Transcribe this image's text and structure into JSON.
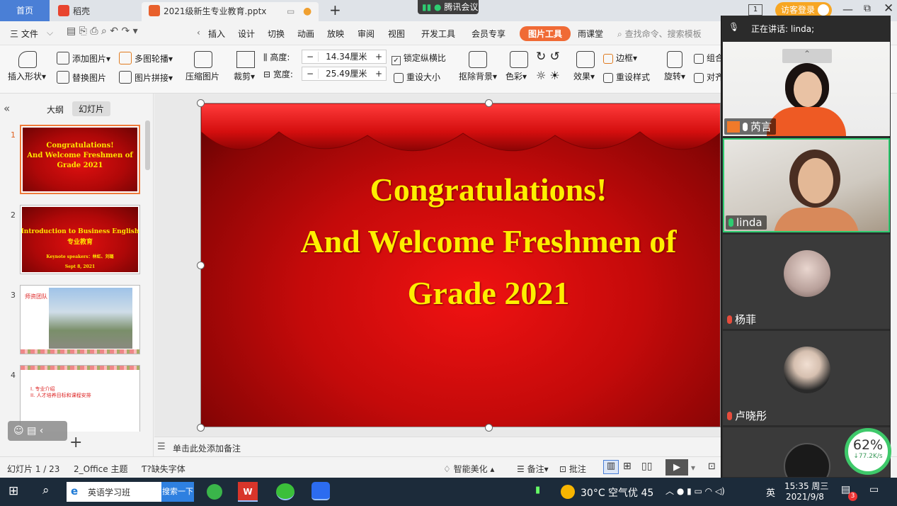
{
  "tabs": {
    "home": "首页",
    "docer": "稻壳",
    "file": "2021级新生专业教育.pptx",
    "meeting_app": "腾讯会议",
    "visitor_login": "访客登录"
  },
  "menu": {
    "file": "三 文件",
    "insert": "插入",
    "design": "设计",
    "transition": "切换",
    "animation": "动画",
    "slideshow": "放映",
    "review": "审阅",
    "view": "视图",
    "devtools": "开发工具",
    "member": "会员专享",
    "picture_tools": "图片工具",
    "rain_class": "雨课堂",
    "search": "查找命令、搜索模板"
  },
  "ribbon": {
    "insert_shape": "插入形状",
    "add_picture": "添加图片",
    "replace_picture": "替换图片",
    "multi_carousel": "多图轮播",
    "picture_splice": "图片拼接",
    "compress": "压缩图片",
    "crop": "裁剪",
    "height_label": "高度:",
    "height_value": "14.34厘米",
    "width_label": "宽度:",
    "width_value": "25.49厘米",
    "lock_ratio": "锁定纵横比",
    "reset_size": "重设大小",
    "remove_bg": "抠除背景",
    "color": "色彩",
    "effects": "效果",
    "border": "边框",
    "reset_style": "重设样式",
    "rotate": "旋转",
    "group": "组合",
    "align": "对齐"
  },
  "left_pane": {
    "outline_tab": "大纲",
    "slides_tab": "幻灯片",
    "slides": [
      {
        "num": "1",
        "lines": [
          "Congratulations!",
          "And Welcome Freshmen of",
          "Grade 2021"
        ]
      },
      {
        "num": "2",
        "title": "Introduction to Business English",
        "subtitle": "专业教育",
        "speakers": "Keynote speakers：林虹、刘璐",
        "date": "Sept 8, 2021"
      },
      {
        "num": "3",
        "label": "师资团队"
      },
      {
        "num": "4",
        "items": [
          "I. 专业介绍",
          "II. 人才培养目标和课程安排"
        ]
      }
    ]
  },
  "slide": {
    "line1": "Congratulations!",
    "line2": "And Welcome Freshmen of",
    "line3": "Grade 2021"
  },
  "notes": {
    "placeholder": "单击此处添加备注"
  },
  "status": {
    "slide_count": "幻灯片 1 / 23",
    "theme": "2_Office 主题",
    "missing_font": "缺失字体",
    "smart_beautify": "智能美化",
    "notes": "备注",
    "comments": "批注"
  },
  "meeting": {
    "speaking": "正在讲话: linda;",
    "participants": [
      {
        "name": "芮言"
      },
      {
        "name": "linda"
      },
      {
        "name": "杨菲"
      },
      {
        "name": "卢晓彤"
      }
    ],
    "network_percent": "62%",
    "network_speed": "↓77.2K/s"
  },
  "taskbar": {
    "search_text": "英语学习班",
    "search_button": "搜索一下",
    "weather": "30°C 空气优 45",
    "ime": "英",
    "time": "15:35 周三",
    "date": "2021/9/8",
    "notification_count": "3"
  },
  "colors": {
    "accent": "#f06a35",
    "title_yellow": "#ffee00",
    "slide_red": "#c40a0a",
    "taskbar": "#1c2b3a"
  }
}
